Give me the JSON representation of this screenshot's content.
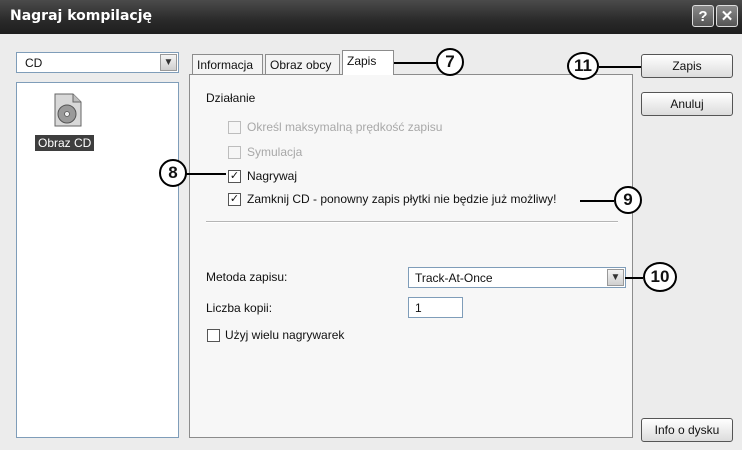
{
  "window": {
    "title": "Nagraj kompilację",
    "help_glyph": "?",
    "close_glyph": "✕"
  },
  "drive": {
    "selected": "CD"
  },
  "files": [
    {
      "label": "Obraz CD",
      "icon": "cd-image-icon"
    }
  ],
  "tabs": [
    {
      "label": "Informacja",
      "active": false
    },
    {
      "label": "Obraz obcy",
      "active": false
    },
    {
      "label": "Zapis",
      "active": true
    }
  ],
  "zapis": {
    "group_label": "Działanie",
    "options": {
      "max_speed": {
        "label": "Określ maksymalną prędkość zapisu",
        "checked": false,
        "enabled": false
      },
      "simulation": {
        "label": "Symulacja",
        "checked": false,
        "enabled": false
      },
      "burn": {
        "label": "Nagrywaj",
        "checked": true,
        "enabled": true
      },
      "close_cd": {
        "label": "Zamknij CD - ponowny zapis płytki nie będzie już możliwy!",
        "checked": true,
        "enabled": true
      }
    },
    "method": {
      "label": "Metoda zapisu:",
      "value": "Track-At-Once"
    },
    "copies": {
      "label": "Liczba kopii:",
      "value": "1"
    },
    "multi_burner": {
      "label": "Użyj wielu nagrywarek",
      "checked": false
    }
  },
  "buttons": {
    "burn": "Zapis",
    "cancel": "Anuluj",
    "disc_info": "Info o dysku"
  },
  "callouts": {
    "c7": "7",
    "c8": "8",
    "c9": "9",
    "c10": "10",
    "c11": "11"
  },
  "check_glyph": "✓"
}
